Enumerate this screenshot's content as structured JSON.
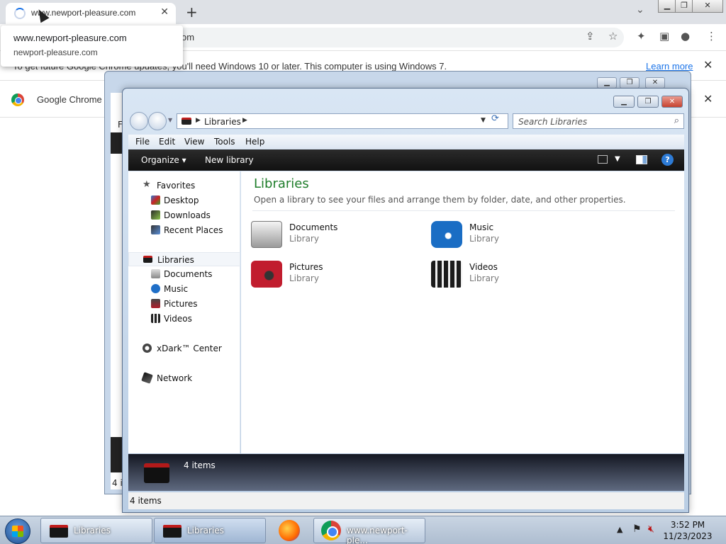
{
  "chrome": {
    "tab_title": "www.newport-pleasure.com",
    "url_visible": "om",
    "hover_title": "www.newport-pleasure.com",
    "hover_url": "newport-pleasure.com",
    "infobar_message": "To get future Google Chrome updates, you'll need Windows 10 or later. This computer is using Windows 7.",
    "infobar_link": "Learn more",
    "chromebar_text": "Google Chrome"
  },
  "back_window": {
    "menu_letter": "F",
    "status_fragment": "4 it"
  },
  "explorer": {
    "breadcrumb": "Libraries",
    "search_placeholder": "Search Libraries",
    "menu": [
      "File",
      "Edit",
      "View",
      "Tools",
      "Help"
    ],
    "commands": {
      "organize": "Organize ▾",
      "new_library": "New library"
    },
    "nav": {
      "favorites": "Favorites",
      "desktop": "Desktop",
      "downloads": "Downloads",
      "recent": "Recent Places",
      "libraries": "Libraries",
      "documents": "Documents",
      "music": "Music",
      "pictures": "Pictures",
      "videos": "Videos",
      "xdark": "xDark™ Center",
      "network": "Network"
    },
    "content": {
      "heading": "Libraries",
      "subheading": "Open a library to see your files and arrange them by folder, date, and other properties.",
      "items": [
        {
          "name": "Documents",
          "type": "Library"
        },
        {
          "name": "Music",
          "type": "Library"
        },
        {
          "name": "Pictures",
          "type": "Library"
        },
        {
          "name": "Videos",
          "type": "Library"
        }
      ]
    },
    "details_count": "4 items",
    "status_count": "4 items"
  },
  "taskbar": {
    "btn1": "Libraries",
    "btn2": "Libraries",
    "btn3": "www.newport-ple...",
    "time": "3:52 PM",
    "date": "11/23/2023"
  },
  "colors": {
    "heading_green": "#1e7d2a",
    "link_blue": "#1a73e8",
    "accent_red": "#c01c1c"
  }
}
